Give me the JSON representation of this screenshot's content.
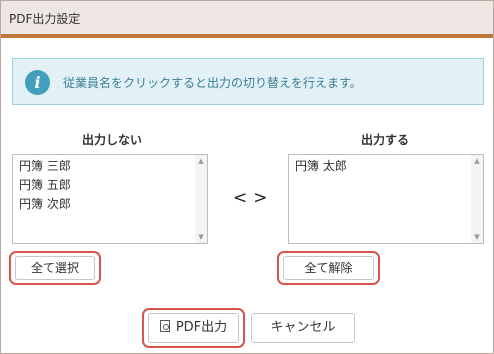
{
  "dialog": {
    "title": "PDF出力設定"
  },
  "info": {
    "icon": "i",
    "message": "従業員名をクリックすると出力の切り替えを行えます。"
  },
  "left": {
    "header": "出力しない",
    "items": [
      "円簿 三郎",
      "円簿 五郎",
      "円簿 次郎"
    ],
    "button": "全て選択"
  },
  "right": {
    "header": "出力する",
    "items": [
      "円簿 太郎"
    ],
    "button": "全て解除"
  },
  "transfer": {
    "left": "<",
    "right": ">"
  },
  "footer": {
    "pdf_button": "PDF出力",
    "cancel_button": "キャンセル"
  },
  "colors": {
    "accent": "#c0773c",
    "highlight": "#d9534f",
    "info_bg": "#e2f1f6",
    "info_icon": "#42a0bd"
  }
}
